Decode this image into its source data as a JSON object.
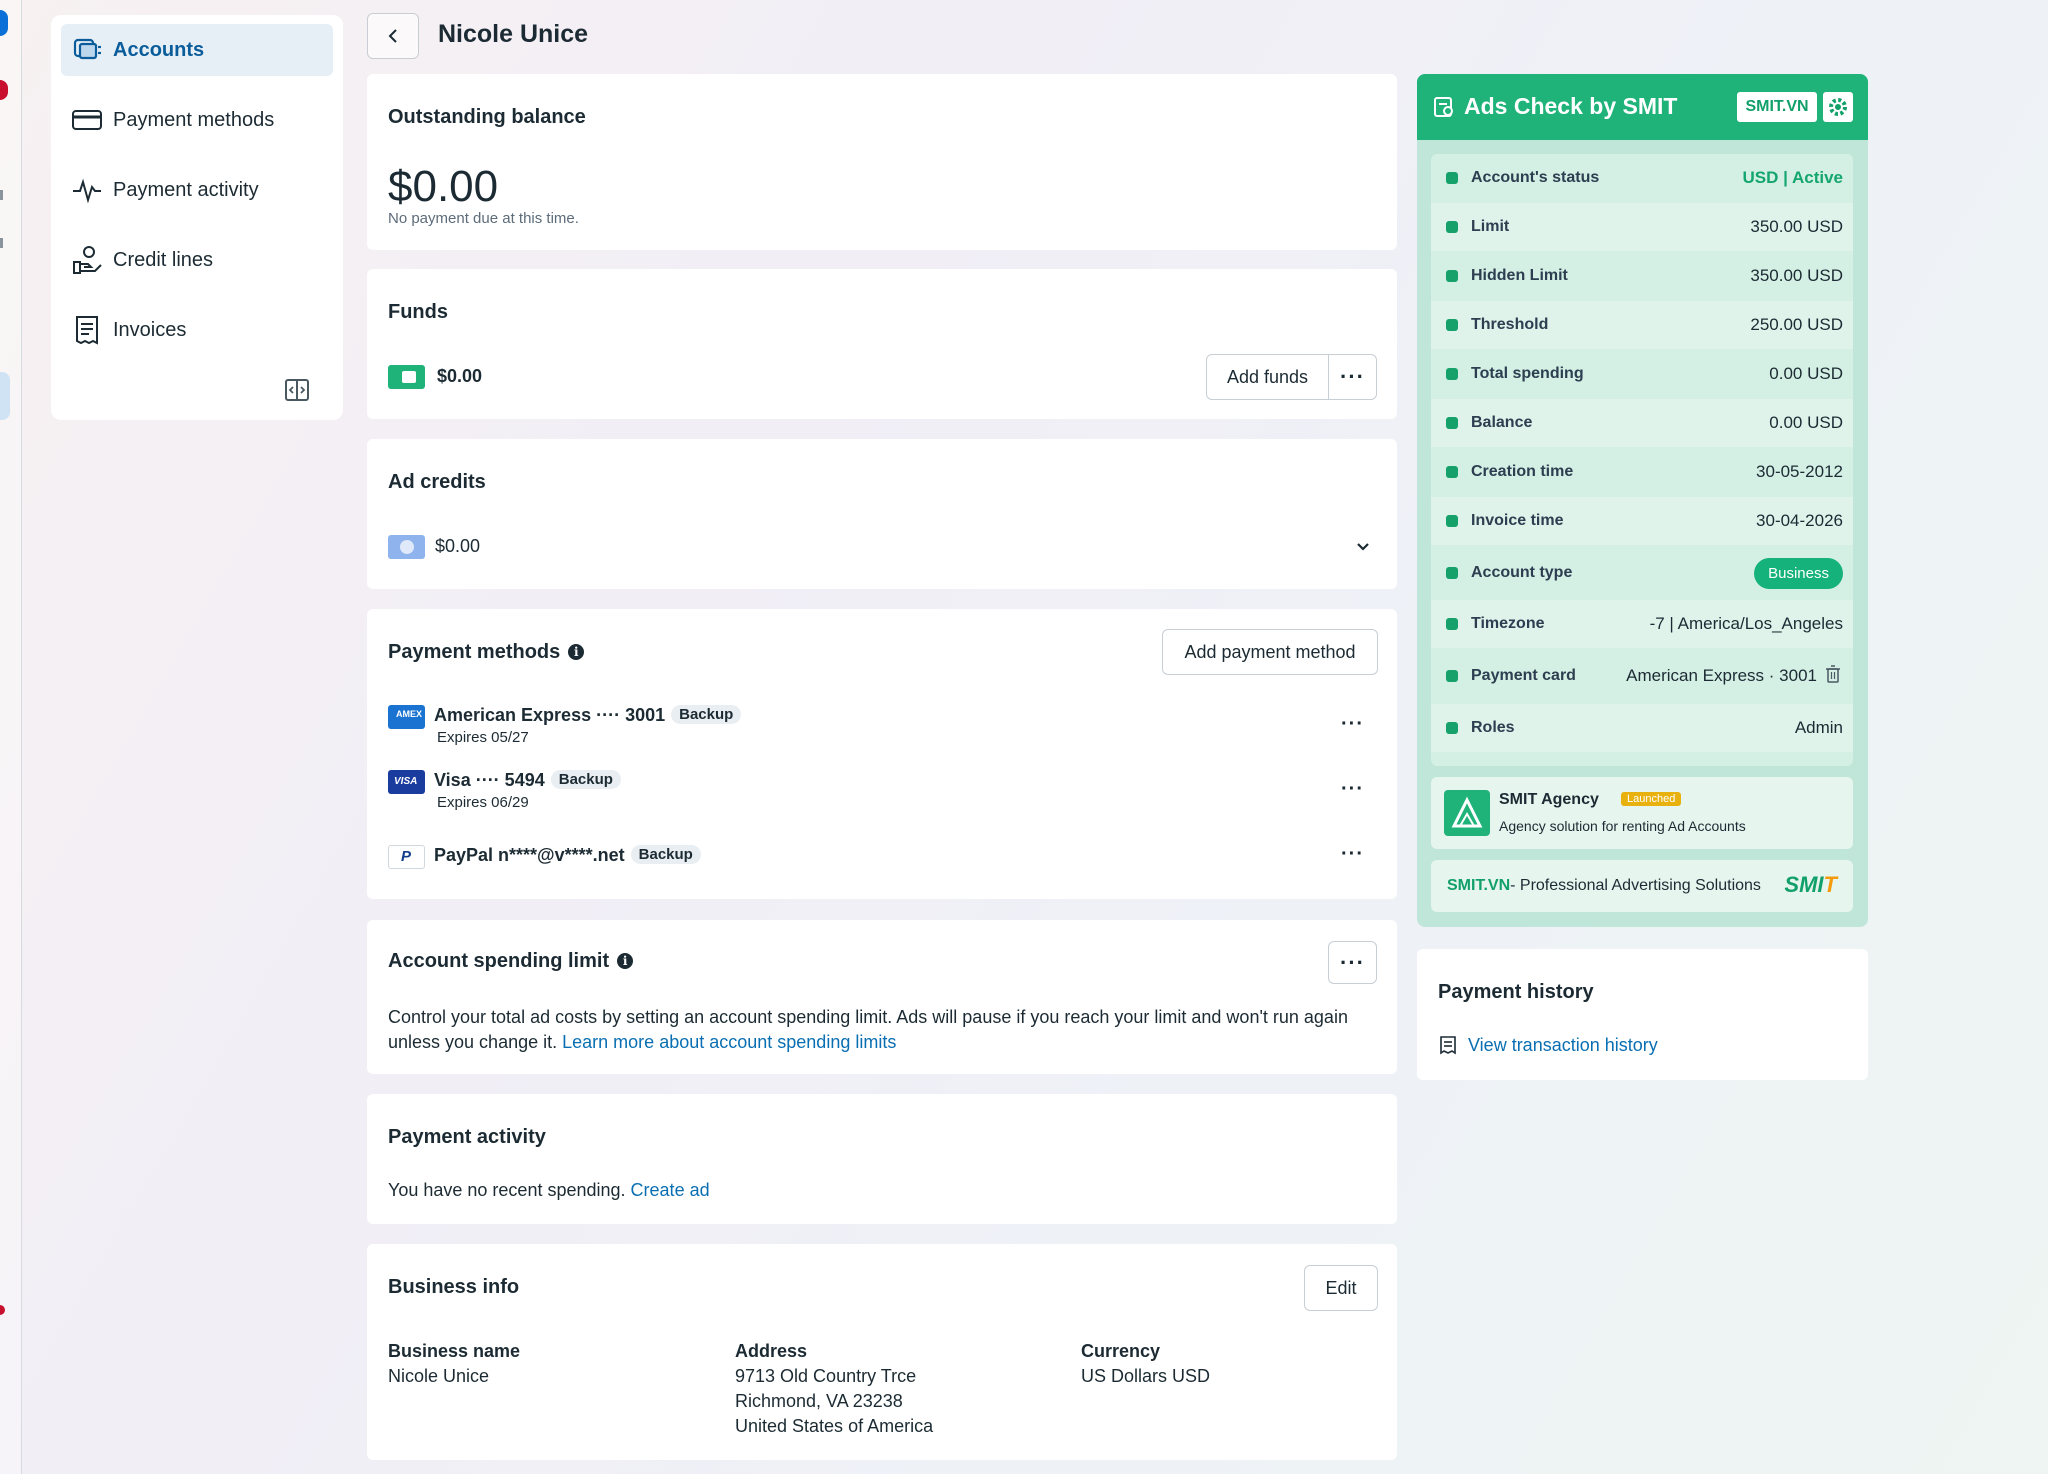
{
  "sidebar": {
    "items": [
      {
        "label": "Accounts",
        "icon": "accounts-icon",
        "active": true
      },
      {
        "label": "Payment methods",
        "icon": "card-icon"
      },
      {
        "label": "Payment activity",
        "icon": "activity-icon"
      },
      {
        "label": "Credit lines",
        "icon": "credit-lines-icon"
      },
      {
        "label": "Invoices",
        "icon": "invoice-icon"
      }
    ]
  },
  "header": {
    "title": "Nicole Unice"
  },
  "outstanding": {
    "title": "Outstanding balance",
    "amount": "$0.00",
    "note": "No payment due at this time."
  },
  "funds": {
    "title": "Funds",
    "amount": "$0.00",
    "add_label": "Add funds",
    "more_label": "···"
  },
  "ad_credits": {
    "title": "Ad credits",
    "amount": "$0.00"
  },
  "payment_methods": {
    "title": "Payment methods",
    "info": "i",
    "add_label": "Add payment method",
    "items": [
      {
        "name": "American Express ···· 3001",
        "badge": "Backup",
        "expires": "Expires 05/27",
        "more": "···",
        "icon_text": "AMEX"
      },
      {
        "name": "Visa ···· 5494",
        "badge": "Backup",
        "expires": "Expires 06/29",
        "more": "···",
        "icon_text": "VISA"
      },
      {
        "name": "PayPal n****@v****.net",
        "badge": "Backup",
        "expires": "",
        "more": "···",
        "icon_text": "P"
      }
    ]
  },
  "spending_limit": {
    "title": "Account spending limit",
    "info": "i",
    "more_label": "···",
    "text": "Control your total ad costs by setting an account spending limit. Ads will pause if you reach your limit and won't run again unless you change it.",
    "link": "Learn more about account spending limits"
  },
  "payment_activity": {
    "title": "Payment activity",
    "text": "You have no recent spending.",
    "link": "Create ad"
  },
  "business_info": {
    "title": "Business info",
    "edit_label": "Edit",
    "name_label": "Business name",
    "name_value": "Nicole Unice",
    "address_label": "Address",
    "address_line1": "9713 Old Country Trce",
    "address_line2": "Richmond, VA 23238",
    "address_line3": "United States of America",
    "currency_label": "Currency",
    "currency_value": "US Dollars USD"
  },
  "smit": {
    "title": "Ads Check by SMIT",
    "tag": "SMIT.VN",
    "rows": [
      {
        "label": "Account's status",
        "value": "USD | Active"
      },
      {
        "label": "Limit",
        "value": "350.00 USD"
      },
      {
        "label": "Hidden Limit",
        "value": "350.00 USD"
      },
      {
        "label": "Threshold",
        "value": "250.00 USD"
      },
      {
        "label": "Total spending",
        "value": "0.00 USD"
      },
      {
        "label": "Balance",
        "value": "0.00 USD"
      },
      {
        "label": "Creation time",
        "value": "30-05-2012"
      },
      {
        "label": "Invoice time",
        "value": "30-04-2026"
      },
      {
        "label": "Account type",
        "value": "Business"
      },
      {
        "label": "Timezone",
        "value": "-7 | America/Los_Angeles"
      },
      {
        "label": "Payment card",
        "value": "American Express · 3001"
      },
      {
        "label": "Roles",
        "value": "Admin"
      }
    ],
    "agency_name": "SMIT Agency",
    "agency_badge": "Launched",
    "agency_sub": "Agency solution for renting Ad Accounts",
    "footer_brand": "SMIT.VN",
    "footer_text": " - Professional Advertising Solutions",
    "logo_main": "SMI",
    "logo_accent": "T",
    "colors": {
      "accent": "#1fb37a",
      "panel": "#bfe6d8",
      "launched": "#e8b10d"
    }
  },
  "history": {
    "title": "Payment history",
    "link": "View transaction history"
  }
}
